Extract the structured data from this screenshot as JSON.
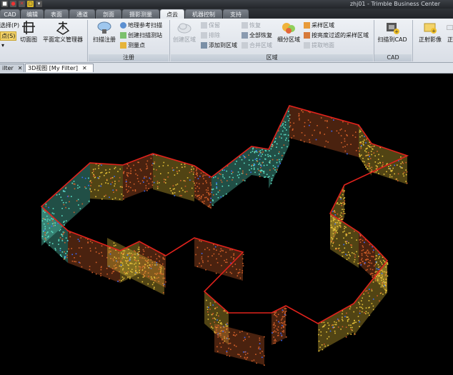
{
  "window": {
    "title": "zhj01 - Trimble Business Center"
  },
  "quick_access": [
    "■",
    "●",
    "✕",
    "▢",
    "▾"
  ],
  "tabs": [
    {
      "label": "CAD"
    },
    {
      "label": "编辑"
    },
    {
      "label": "表面"
    },
    {
      "label": "通道"
    },
    {
      "label": "剖面"
    },
    {
      "label": "摄影测量"
    },
    {
      "label": "点云"
    },
    {
      "label": "机器控制"
    },
    {
      "label": "支持"
    }
  ],
  "active_tab": "点云",
  "ribbon": {
    "left_cut": {
      "line1": "选择(P)",
      "line2": "点(S)",
      "line3": "▾"
    },
    "section_view": "切面图",
    "plane_manager": "平面定义管理器",
    "scan_register": "扫描注册",
    "create_ref_scan": "地理参考扫描",
    "create_station": "创建扫描测站",
    "measure_point": "测量点",
    "group_register": "注册",
    "create_region": "创建区域",
    "save": "保留",
    "delete": "排除",
    "add_to_region": "添加到区域",
    "restore": "恢复",
    "restore_all": "全部恢复",
    "merge_region": "合并区域",
    "segment_region": "细分区域",
    "sample_region": "采样区域",
    "filter_sample": "按亮度过滤的采样区域",
    "extract_surface": "提取地面",
    "group_region": "区域",
    "scan_to_cad": "扫描到CAD",
    "group_cad": "CAD",
    "orthophoto": "正射影像",
    "more": "正"
  },
  "doc_tabs": {
    "left_tab": "ilter",
    "left_close": "✕",
    "active_tab": "3D视图 [My Filter]",
    "active_close": "✕"
  },
  "colors": {
    "background": "#000000",
    "boundary": "#e0221c",
    "cyan": "#5fe3c8",
    "yellow": "#e8c23a",
    "orange": "#d4602a",
    "blue": "#3a6cff"
  }
}
